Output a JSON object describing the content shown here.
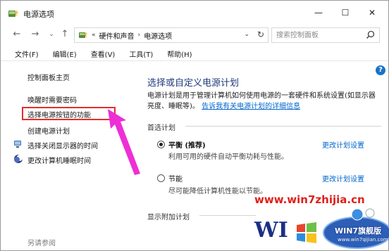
{
  "window": {
    "title": "电源选项",
    "minimize_glyph": "—",
    "maximize_glyph": "☐",
    "close_glyph": "✕"
  },
  "nav": {
    "back_glyph": "←",
    "forward_glyph": "→",
    "recent_glyph": "⌄",
    "up_glyph": "↑",
    "overflow": "«",
    "crumbs": [
      "硬件和声音",
      "电源选项"
    ],
    "crumb_sep": "›",
    "dropdown_glyph": "⌄",
    "refresh_glyph": "↻",
    "search_placeholder": "搜索控制面板"
  },
  "menu": {
    "items": [
      "文件(F)",
      "编辑(E)",
      "查看(V)",
      "工具(T)",
      "帮助(H)"
    ]
  },
  "sidebar": {
    "items": [
      {
        "label": "控制面板主页"
      },
      {
        "label": "唤醒时需要密码"
      },
      {
        "label": "选择电源按钮的功能"
      },
      {
        "label": "创建电源计划"
      },
      {
        "label": "选择关闭显示器的时间"
      },
      {
        "label": "更改计算机睡眠时间"
      }
    ],
    "see_also": "另请参阅"
  },
  "main": {
    "title": "选择或自定义电源计划",
    "desc_text": "电源计划是用于管理计算机如何使用电源的一套硬件和系统设置(如显示器亮度、睡眠等)。",
    "desc_link": "告诉我有关电源计划的详细信息",
    "preferred_label": "首选计划",
    "plans": [
      {
        "name": "平衡 (推荐)",
        "desc": "利用可用的硬件自动平衡功耗与性能。",
        "change": "更改计划设置",
        "selected": true
      },
      {
        "name": "节能",
        "desc": "尽可能降低计算机性能以节能。",
        "change": "更改计划设置",
        "selected": false
      }
    ],
    "extra_label": "显示附加计划"
  },
  "help_glyph": "?",
  "watermark": {
    "url": "www.win7zhijia.cn",
    "brand": "WIN7旗舰版",
    "sub": "www.win7qijian.com"
  },
  "colors": {
    "accent_red": "#e0302c",
    "arrow_pink": "#ee2fd6",
    "link_blue": "#0066cc",
    "title_blue": "#1e3a7a"
  }
}
